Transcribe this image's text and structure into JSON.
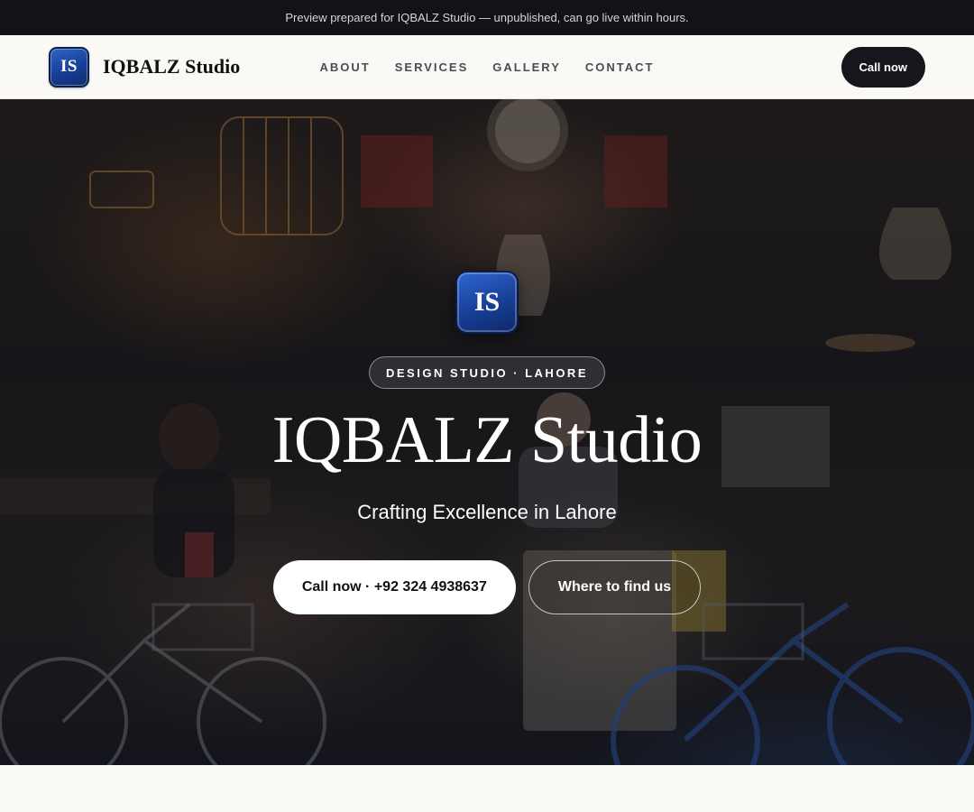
{
  "banner": {
    "text": "Preview prepared for IQBALZ Studio — unpublished, can go live within hours."
  },
  "navbar": {
    "logo_initials": "IS",
    "brand_name": "IQBALZ Studio",
    "links": [
      {
        "label": "ABOUT"
      },
      {
        "label": "SERVICES"
      },
      {
        "label": "GALLERY"
      },
      {
        "label": "CONTACT"
      }
    ],
    "cta_label": "Call now"
  },
  "hero": {
    "logo_initials": "IS",
    "tagline_pill": "DESIGN STUDIO · LAHORE",
    "title": "IQBALZ Studio",
    "subtitle": "Crafting Excellence in Lahore",
    "primary_button": "Call now · +92 324 4938637",
    "secondary_button": "Where to find us",
    "background_image": "shop-interior-photo"
  },
  "colors": {
    "banner_bg": "#111318",
    "nav_bg": "#faf9f6",
    "brand_blue": "#173f96",
    "dark_button": "#15171c"
  }
}
